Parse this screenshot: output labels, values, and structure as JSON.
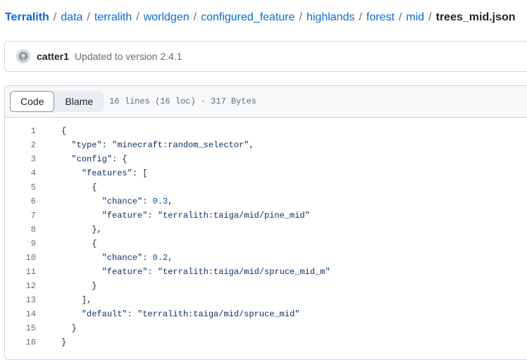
{
  "breadcrumb": {
    "segments": [
      "Terralith",
      "data",
      "terralith",
      "worldgen",
      "configured_feature",
      "highlands",
      "forest",
      "mid"
    ],
    "separator": "/",
    "current": "trees_mid.json",
    "copy_icon": "copy-icon"
  },
  "commit": {
    "author": "catter1",
    "message": "Updated to version 2.4.1",
    "avatar_icon": "github-avatar-icon"
  },
  "file": {
    "code_label": "Code",
    "blame_label": "Blame",
    "meta": "16 lines (16 loc) · 317 Bytes",
    "lines": [
      {
        "n": "1",
        "tokens": [
          [
            "p",
            "{"
          ]
        ]
      },
      {
        "n": "2",
        "tokens": [
          [
            "p",
            "  "
          ],
          [
            "key",
            "\"type\""
          ],
          [
            "p",
            ": "
          ],
          [
            "str",
            "\"minecraft:random_selector\""
          ],
          [
            "p",
            ","
          ]
        ]
      },
      {
        "n": "3",
        "tokens": [
          [
            "p",
            "  "
          ],
          [
            "key",
            "\"config\""
          ],
          [
            "p",
            ": {"
          ]
        ]
      },
      {
        "n": "4",
        "tokens": [
          [
            "p",
            "    "
          ],
          [
            "key",
            "\"features\""
          ],
          [
            "p",
            ": ["
          ]
        ]
      },
      {
        "n": "5",
        "tokens": [
          [
            "p",
            "      {"
          ]
        ]
      },
      {
        "n": "6",
        "tokens": [
          [
            "p",
            "        "
          ],
          [
            "key",
            "\"chance\""
          ],
          [
            "p",
            ": "
          ],
          [
            "num",
            "0.3"
          ],
          [
            "p",
            ","
          ]
        ]
      },
      {
        "n": "7",
        "tokens": [
          [
            "p",
            "        "
          ],
          [
            "key",
            "\"feature\""
          ],
          [
            "p",
            ": "
          ],
          [
            "str",
            "\"terralith:taiga/mid/pine_mid\""
          ]
        ]
      },
      {
        "n": "8",
        "tokens": [
          [
            "p",
            "      },"
          ]
        ]
      },
      {
        "n": "9",
        "tokens": [
          [
            "p",
            "      {"
          ]
        ]
      },
      {
        "n": "10",
        "tokens": [
          [
            "p",
            "        "
          ],
          [
            "key",
            "\"chance\""
          ],
          [
            "p",
            ": "
          ],
          [
            "num",
            "0.2"
          ],
          [
            "p",
            ","
          ]
        ]
      },
      {
        "n": "11",
        "tokens": [
          [
            "p",
            "        "
          ],
          [
            "key",
            "\"feature\""
          ],
          [
            "p",
            ": "
          ],
          [
            "str",
            "\"terralith:taiga/mid/spruce_mid_m\""
          ]
        ]
      },
      {
        "n": "12",
        "tokens": [
          [
            "p",
            "      }"
          ]
        ]
      },
      {
        "n": "13",
        "tokens": [
          [
            "p",
            "    ],"
          ]
        ]
      },
      {
        "n": "14",
        "tokens": [
          [
            "p",
            "    "
          ],
          [
            "key",
            "\"default\""
          ],
          [
            "p",
            ": "
          ],
          [
            "str",
            "\"terralith:taiga/mid/spruce_mid\""
          ]
        ]
      },
      {
        "n": "15",
        "tokens": [
          [
            "p",
            "  }"
          ]
        ]
      },
      {
        "n": "16",
        "tokens": [
          [
            "p",
            "}"
          ]
        ]
      }
    ]
  },
  "colors": {
    "link": "#0969da",
    "text": "#1f2328",
    "muted": "#656d76",
    "border": "#d0d7de",
    "json_string": "#0a3069",
    "json_number": "#0550ae"
  }
}
